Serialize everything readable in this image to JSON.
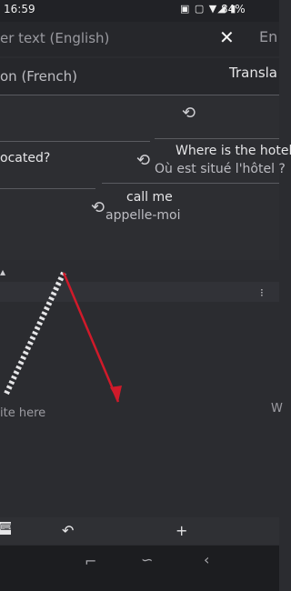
{
  "status_bar": {
    "time": "16:59",
    "icons": "▣ ▢ ▼◢ ▮",
    "battery": "84%"
  },
  "input_panel": {
    "text": "er text (English)",
    "right_text": "En"
  },
  "translation_panel": {
    "text": "on (French)",
    "right_text": "Transla"
  },
  "chat": {
    "row1_left": "",
    "row2_left": "ocated?",
    "row2_right_top": "Where is the hotel",
    "row2_right_bottom": "Où est situé l'hôtel ?",
    "row3_top": "call me",
    "row3_bottom": "appelle-moi"
  },
  "lower": {
    "label": "ite here",
    "right_label": "W"
  },
  "colors": {
    "arrow": "#d01a2a",
    "background": "#2b2c30"
  }
}
